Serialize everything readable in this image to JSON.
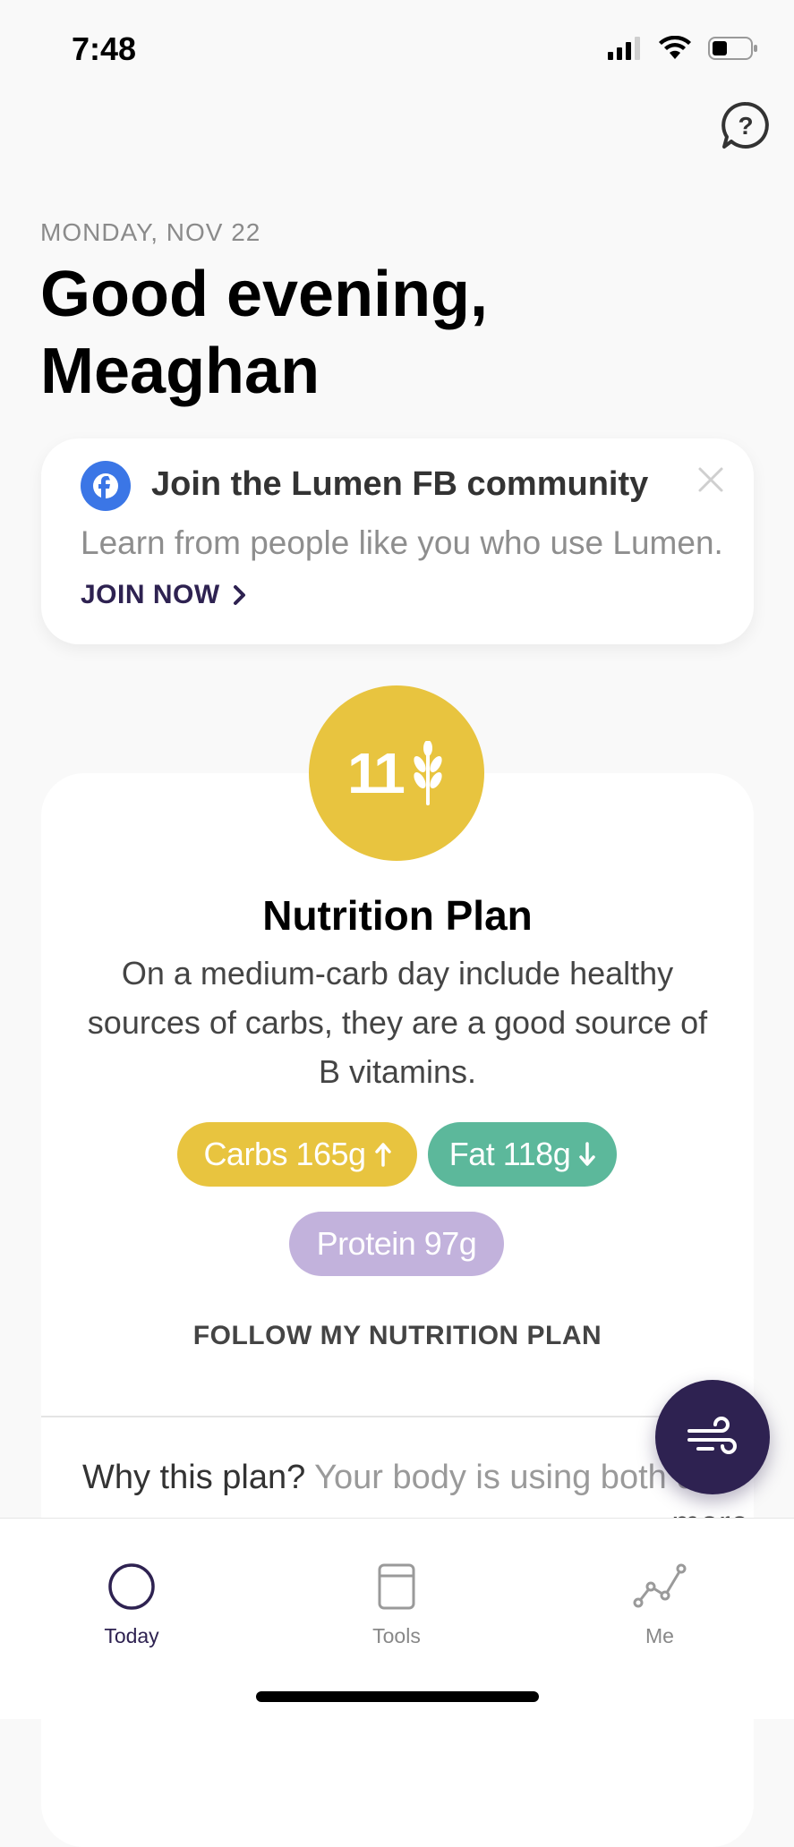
{
  "status_bar": {
    "time": "7:48"
  },
  "header": {
    "date": "MONDAY, NOV 22",
    "greeting_line1": "Good evening,",
    "greeting_line2": "Meaghan"
  },
  "fb_card": {
    "title": "Join the Lumen FB community",
    "description": "Learn from people like you who use Lumen.",
    "join_label": "JOIN NOW",
    "brand_color": "#3b76e6"
  },
  "nutrition_plan": {
    "badge_number": "11",
    "title": "Nutrition Plan",
    "description": "On a medium-carb day include healthy sources of carbs, they are a good source of B vitamins.",
    "macros": {
      "carbs_label": "Carbs 165g",
      "fat_label": "Fat 118g",
      "protein_label": "Protein 97g"
    },
    "follow_label": "FOLLOW MY NUTRITION PLAN",
    "why_lead": "Why this plan? ",
    "why_detail": "Your body is using both carbs and fat, this means your body",
    "why_more": "... more",
    "colors": {
      "carbs": "#e8c43f",
      "fat": "#5cb89b",
      "protein": "#c2b2dc",
      "accent": "#2e2251"
    }
  },
  "tabbar": {
    "today": "Today",
    "tools": "Tools",
    "me": "Me"
  }
}
